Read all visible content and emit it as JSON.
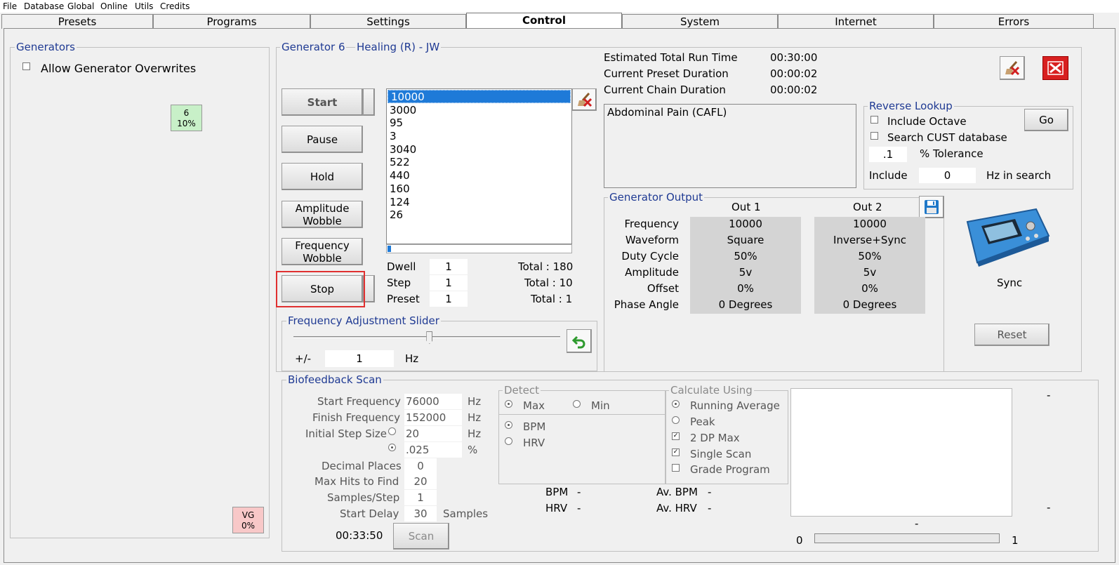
{
  "menu": [
    "File",
    "Database",
    "Global",
    "Online",
    "Utils",
    "Credits"
  ],
  "tabs": [
    "Presets",
    "Programs",
    "Settings",
    "Control",
    "System",
    "Internet",
    "Errors"
  ],
  "generators": {
    "title": "Generators",
    "allow_overwrites": "Allow Generator Overwrites",
    "gen6": {
      "num": "6",
      "pct": "10%"
    },
    "vg": {
      "num": "VG",
      "pct": "0%"
    }
  },
  "generator": {
    "title": "Generator 6",
    "program": "Healing (R) - JW",
    "buttons": {
      "start": "Start",
      "pause": "Pause",
      "hold": "Hold",
      "amp1": "Amplitude",
      "amp2": "Wobble",
      "freq1": "Frequency",
      "freq2": "Wobble",
      "stop": "Stop"
    },
    "freqs": [
      "10000",
      "3000",
      "95",
      "3",
      "3040",
      "522",
      "440",
      "160",
      "124",
      "26"
    ],
    "progress": 0.02,
    "dwell": {
      "label": "Dwell",
      "value": "1",
      "total": "Total : 180"
    },
    "step": {
      "label": "Step",
      "value": "1",
      "total": "Total : 10"
    },
    "preset": {
      "label": "Preset",
      "value": "1",
      "total": "Total : 1"
    }
  },
  "times": {
    "est_label": "Estimated Total Run Time",
    "est_value": "00:30:00",
    "preset_label": "Current Preset Duration",
    "preset_value": "00:00:02",
    "chain_label": "Current Chain Duration",
    "chain_value": "00:00:02"
  },
  "description": "Abdominal Pain (CAFL)",
  "reverse": {
    "title": "Reverse Lookup",
    "octave": "Include Octave",
    "cust": "Search CUST database",
    "go": "Go",
    "tol_value": ".1",
    "tol_label": "% Tolerance",
    "include_label": "Include",
    "include_value": "0",
    "include_suffix": "Hz in search"
  },
  "output": {
    "title": "Generator Output",
    "out1": "Out 1",
    "out2": "Out 2",
    "rows": [
      {
        "label": "Frequency",
        "v1": "10000",
        "v2": "10000"
      },
      {
        "label": "Waveform",
        "v1": "Square",
        "v2": "Inverse+Sync"
      },
      {
        "label": "Duty Cycle",
        "v1": "50%",
        "v2": "50%"
      },
      {
        "label": "Amplitude",
        "v1": "5v",
        "v2": "5v"
      },
      {
        "label": "Offset",
        "v1": "0%",
        "v2": "0%"
      },
      {
        "label": "Phase Angle",
        "v1": "0 Degrees",
        "v2": "0 Degrees"
      }
    ]
  },
  "device": {
    "label": "Sync",
    "reset": "Reset"
  },
  "slider": {
    "title": "Frequency Adjustment Slider",
    "pm": "+/-",
    "value": "1",
    "unit": "Hz",
    "position": 0.51
  },
  "bio": {
    "title": "Biofeedback Scan",
    "start_label": "Start Frequency",
    "start_value": "76000",
    "start_unit": "Hz",
    "finish_label": "Finish Frequency",
    "finish_value": "152000",
    "finish_unit": "Hz",
    "step_label": "Initial Step Size",
    "step_value": "20",
    "step_unit": "Hz",
    "step_pct_value": ".025",
    "step_pct_unit": "%",
    "dec_label": "Decimal Places",
    "dec_value": "0",
    "hits_label": "Max Hits to Find",
    "hits_value": "20",
    "samples_label": "Samples/Step",
    "samples_value": "1",
    "delay_label": "Start Delay",
    "delay_value": "30",
    "delay_unit": "Samples",
    "timer": "00:33:50",
    "scan": "Scan",
    "detect": {
      "title": "Detect",
      "max": "Max",
      "min": "Min",
      "bpm": "BPM",
      "hrv": "HRV"
    },
    "calc": {
      "title": "Calculate Using",
      "running": "Running Average",
      "peak": "Peak",
      "dp": "2 DP Max",
      "single": "Single Scan",
      "grade": "Grade Program"
    },
    "readouts": {
      "bpm": "BPM",
      "bpm_val": "-",
      "hrv": "HRV",
      "hrv_val": "-",
      "avbpm": "Av. BPM",
      "avbpm_val": "-",
      "avhrv": "Av. HRV",
      "avhrv_val": "-"
    },
    "graph": {
      "dash_top": "-",
      "dash_mid": "-",
      "dash_bottom": "-",
      "min": "0",
      "max": "1"
    }
  }
}
